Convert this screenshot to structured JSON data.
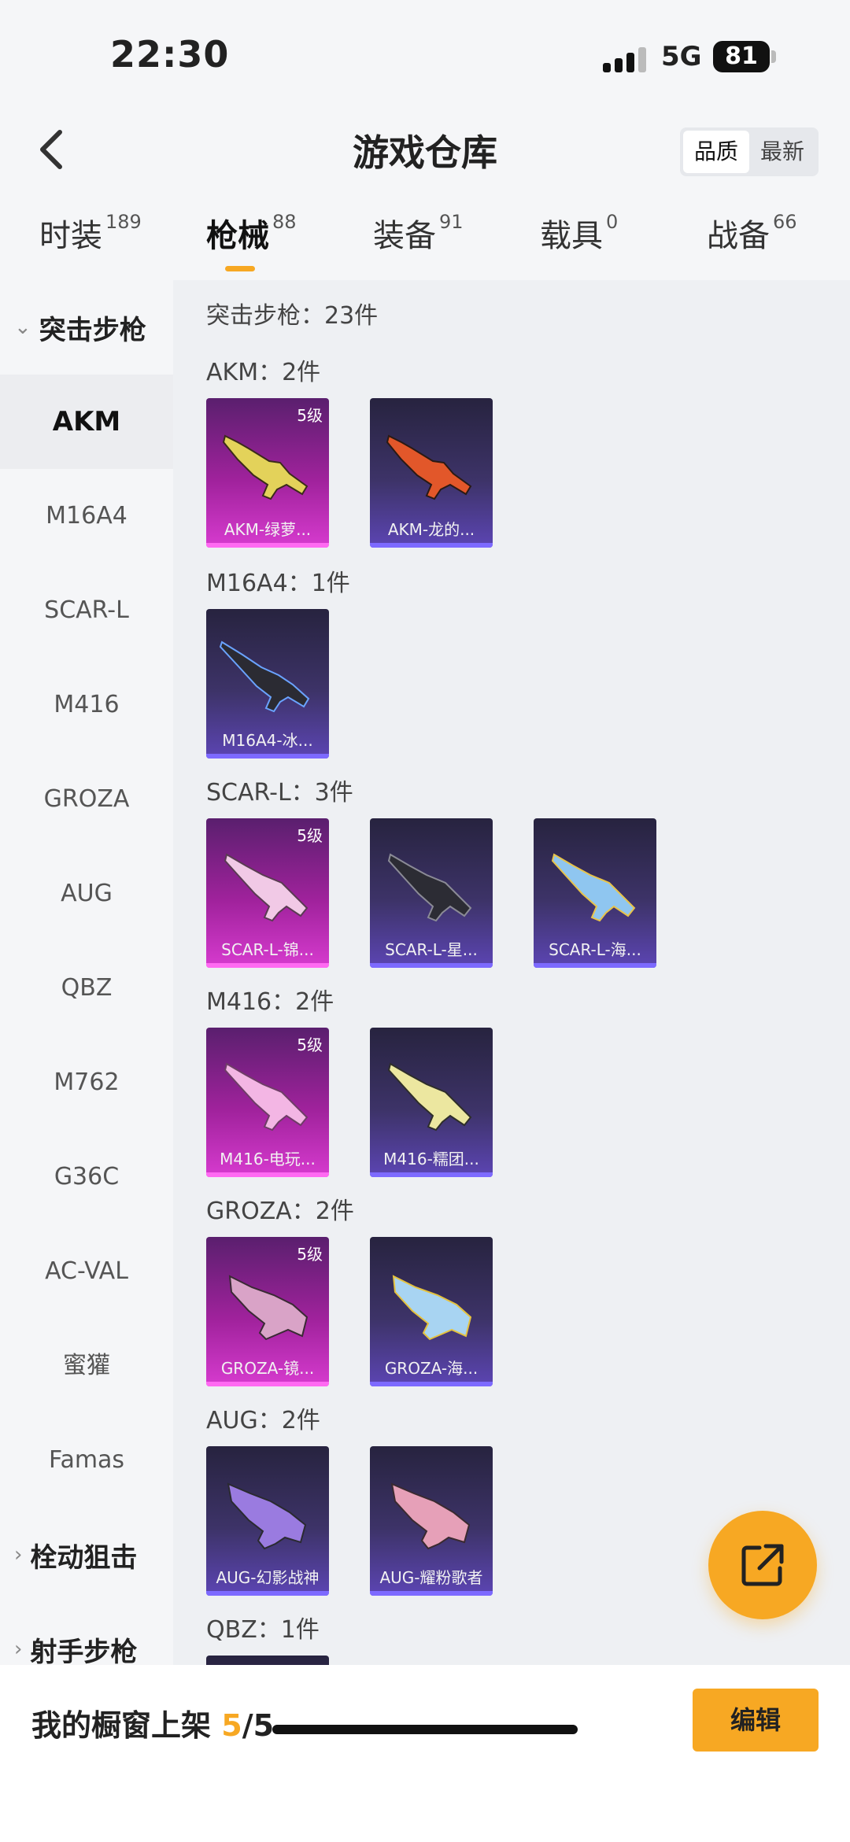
{
  "status": {
    "time": "22:30",
    "network": "5G",
    "battery": "81"
  },
  "header": {
    "title": "游戏仓库",
    "sort_options": [
      "品质",
      "最新"
    ],
    "sort_active": "品质"
  },
  "tabs": [
    {
      "label": "时装",
      "count": "189"
    },
    {
      "label": "枪械",
      "count": "88",
      "active": true
    },
    {
      "label": "装备",
      "count": "91"
    },
    {
      "label": "载具",
      "count": "0"
    },
    {
      "label": "战备",
      "count": "66"
    }
  ],
  "sidebar": {
    "group_expanded": "突击步枪",
    "items": [
      "AKM",
      "M16A4",
      "SCAR-L",
      "M416",
      "GROZA",
      "AUG",
      "QBZ",
      "M762",
      "G36C",
      "AC-VAL",
      "蜜獾",
      "Famas"
    ],
    "active_item": "AKM",
    "collapsed_groups": [
      "栓动狙击",
      "射手步枪"
    ]
  },
  "content": {
    "summary": "突击步枪：23件",
    "sections": [
      {
        "title": "AKM：2件",
        "items": [
          {
            "name": "AKM-绿萝...",
            "tier": "5级",
            "rarity": "gold"
          },
          {
            "name": "AKM-龙的...",
            "tier": "",
            "rarity": "purple"
          }
        ]
      },
      {
        "title": "M16A4：1件",
        "items": [
          {
            "name": "M16A4-冰...",
            "tier": "",
            "rarity": "purple"
          }
        ]
      },
      {
        "title": "SCAR-L：3件",
        "items": [
          {
            "name": "SCAR-L-锦...",
            "tier": "5级",
            "rarity": "gold"
          },
          {
            "name": "SCAR-L-星...",
            "tier": "",
            "rarity": "purple"
          },
          {
            "name": "SCAR-L-海...",
            "tier": "",
            "rarity": "purple"
          }
        ]
      },
      {
        "title": "M416：2件",
        "items": [
          {
            "name": "M416-电玩...",
            "tier": "5级",
            "rarity": "gold"
          },
          {
            "name": "M416-糯团...",
            "tier": "",
            "rarity": "purple"
          }
        ]
      },
      {
        "title": "GROZA：2件",
        "items": [
          {
            "name": "GROZA-镜...",
            "tier": "5级",
            "rarity": "gold"
          },
          {
            "name": "GROZA-海...",
            "tier": "",
            "rarity": "purple"
          }
        ]
      },
      {
        "title": "AUG：2件",
        "items": [
          {
            "name": "AUG-幻影战神",
            "tier": "",
            "rarity": "purple"
          },
          {
            "name": "AUG-耀粉歌者",
            "tier": "",
            "rarity": "purple"
          }
        ]
      },
      {
        "title": "QBZ：1件",
        "items": []
      }
    ]
  },
  "bottom": {
    "showcase_label": "我的橱窗上架",
    "showcase_current": "5",
    "showcase_total": "/5",
    "edit_label": "编辑"
  },
  "colors": {
    "accent": "#f7a823",
    "gold_card": "#a0229c",
    "purple_card": "#3d3368"
  },
  "icons": {
    "back": "chevron-left-icon",
    "fab": "share-external-icon",
    "collapse": "chevron-right-icon",
    "expand": "chevron-down-icon"
  }
}
